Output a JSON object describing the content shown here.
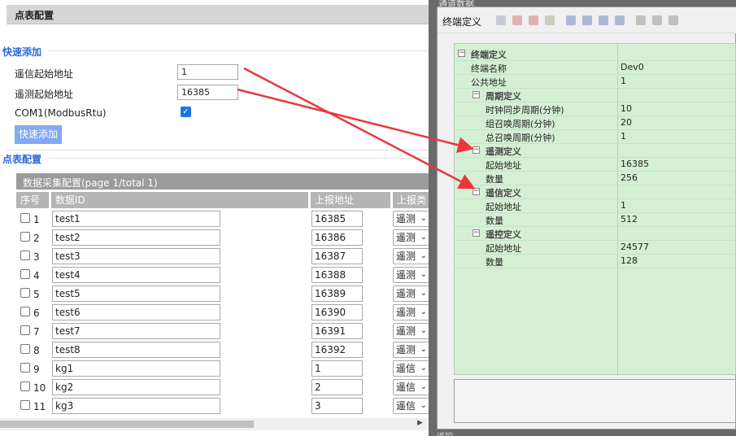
{
  "left": {
    "title": "点表配置",
    "quick_add": {
      "heading": "快速添加",
      "yx_label": "遥信起始地址",
      "yx_value": "1",
      "yc_label": "遥测起始地址",
      "yc_value": "16385",
      "com_label": "COM1(ModbusRtu)",
      "com_checked": true,
      "button_label": "快速添加"
    },
    "table": {
      "heading": "点表配置",
      "title": "数据采集配置(page 1/total 1)",
      "columns": [
        "序号",
        "数据ID",
        "上报地址",
        "上报类"
      ],
      "rows": [
        {
          "num": "1",
          "id": "test1",
          "addr": "16385",
          "type": "遥测"
        },
        {
          "num": "2",
          "id": "test2",
          "addr": "16386",
          "type": "遥测"
        },
        {
          "num": "3",
          "id": "test3",
          "addr": "16387",
          "type": "遥测"
        },
        {
          "num": "4",
          "id": "test4",
          "addr": "16388",
          "type": "遥测"
        },
        {
          "num": "5",
          "id": "test5",
          "addr": "16389",
          "type": "遥测"
        },
        {
          "num": "6",
          "id": "test6",
          "addr": "16390",
          "type": "遥测"
        },
        {
          "num": "7",
          "id": "test7",
          "addr": "16391",
          "type": "遥测"
        },
        {
          "num": "8",
          "id": "test8",
          "addr": "16392",
          "type": "遥测"
        },
        {
          "num": "9",
          "id": "kg1",
          "addr": "1",
          "type": "遥信"
        },
        {
          "num": "10",
          "id": "kg2",
          "addr": "2",
          "type": "遥信"
        },
        {
          "num": "11",
          "id": "kg3",
          "addr": "3",
          "type": "遥信"
        }
      ]
    }
  },
  "right": {
    "caption": "通道数据",
    "toolbar_title": "终端定义",
    "properties": [
      {
        "kind": "category",
        "level": 0,
        "label": "终端定义"
      },
      {
        "kind": "prop",
        "level": 0,
        "label": "终端名称",
        "value": "Dev0"
      },
      {
        "kind": "prop",
        "level": 0,
        "label": "公共地址",
        "value": "1"
      },
      {
        "kind": "category",
        "level": 1,
        "label": "周期定义"
      },
      {
        "kind": "prop",
        "level": 1,
        "label": "时钟同步周期(分钟)",
        "value": "10"
      },
      {
        "kind": "prop",
        "level": 1,
        "label": "组召唤周期(分钟)",
        "value": "20"
      },
      {
        "kind": "prop",
        "level": 1,
        "label": "总召唤周期(分钟)",
        "value": "1"
      },
      {
        "kind": "category",
        "level": 1,
        "label": "遥测定义"
      },
      {
        "kind": "prop",
        "level": 1,
        "label": "起始地址",
        "value": "16385"
      },
      {
        "kind": "prop",
        "level": 1,
        "label": "数量",
        "value": "256"
      },
      {
        "kind": "category",
        "level": 1,
        "label": "遥信定义"
      },
      {
        "kind": "prop",
        "level": 1,
        "label": "起始地址",
        "value": "1"
      },
      {
        "kind": "prop",
        "level": 1,
        "label": "数量",
        "value": "512"
      },
      {
        "kind": "category",
        "level": 1,
        "label": "遥控定义"
      },
      {
        "kind": "prop",
        "level": 1,
        "label": "起始地址",
        "value": "24577"
      },
      {
        "kind": "prop",
        "level": 1,
        "label": "数量",
        "value": "128"
      }
    ],
    "footer": "遥控"
  },
  "colors": {
    "accent_blue": "#2d6ad8",
    "button_blue": "#82a9f2",
    "property_green": "#d5efd4",
    "arrow_red": "#e8383b"
  }
}
